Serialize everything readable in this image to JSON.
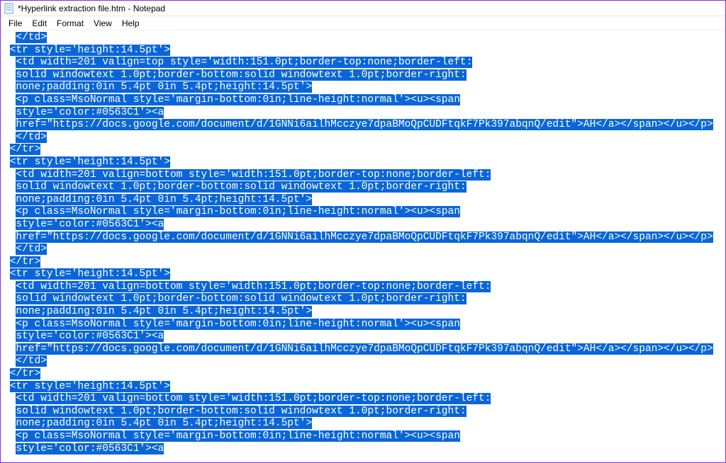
{
  "window": {
    "title": "*Hyperlink extraction file.htm - Notepad"
  },
  "menu": {
    "file": "File",
    "edit": "Edit",
    "format": "Format",
    "view": "View",
    "help": "Help"
  },
  "colors": {
    "selection_bg": "#0a66d8",
    "selection_fg": "#ffffff"
  },
  "content": {
    "lines": [
      "  </td>",
      " <tr style='height:14.5pt'>",
      "  <td width=201 valign=top style='width:151.0pt;border-top:none;border-left:",
      "  solid windowtext 1.0pt;border-bottom:solid windowtext 1.0pt;border-right:",
      "  none;padding:0in 5.4pt 0in 5.4pt;height:14.5pt'>",
      "  <p class=MsoNormal style='margin-bottom:0in;line-height:normal'><u><span",
      "  style='color:#0563C1'><a",
      "  href=\"https://docs.google.com/document/d/1GNNi6ailhMcczye7dpaBMoQpCUDFtqkF7Pk397abqnQ/edit\">AH</a></span></u></p>",
      "  </td>",
      " </tr>",
      " <tr style='height:14.5pt'>",
      "  <td width=201 valign=bottom style='width:151.0pt;border-top:none;border-left:",
      "  solid windowtext 1.0pt;border-bottom:solid windowtext 1.0pt;border-right:",
      "  none;padding:0in 5.4pt 0in 5.4pt;height:14.5pt'>",
      "  <p class=MsoNormal style='margin-bottom:0in;line-height:normal'><u><span",
      "  style='color:#0563C1'><a",
      "  href=\"https://docs.google.com/document/d/1GNNi6ailhMcczye7dpaBMoQpCUDFtqkF7Pk397abqnQ/edit\">AH</a></span></u></p>",
      "  </td>",
      " </tr>",
      " <tr style='height:14.5pt'>",
      "  <td width=201 valign=bottom style='width:151.0pt;border-top:none;border-left:",
      "  solid windowtext 1.0pt;border-bottom:solid windowtext 1.0pt;border-right:",
      "  none;padding:0in 5.4pt 0in 5.4pt;height:14.5pt'>",
      "  <p class=MsoNormal style='margin-bottom:0in;line-height:normal'><u><span",
      "  style='color:#0563C1'><a",
      "  href=\"https://docs.google.com/document/d/1GNNi6ailhMcczye7dpaBMoQpCUDFtqkF7Pk397abqnQ/edit\">AH</a></span></u></p>",
      "  </td>",
      " </tr>",
      " <tr style='height:14.5pt'>",
      "  <td width=201 valign=bottom style='width:151.0pt;border-top:none;border-left:",
      "  solid windowtext 1.0pt;border-bottom:solid windowtext 1.0pt;border-right:",
      "  none;padding:0in 5.4pt 0in 5.4pt;height:14.5pt'>",
      "  <p class=MsoNormal style='margin-bottom:0in;line-height:normal'><u><span",
      "  style='color:#0563C1'><a"
    ]
  }
}
